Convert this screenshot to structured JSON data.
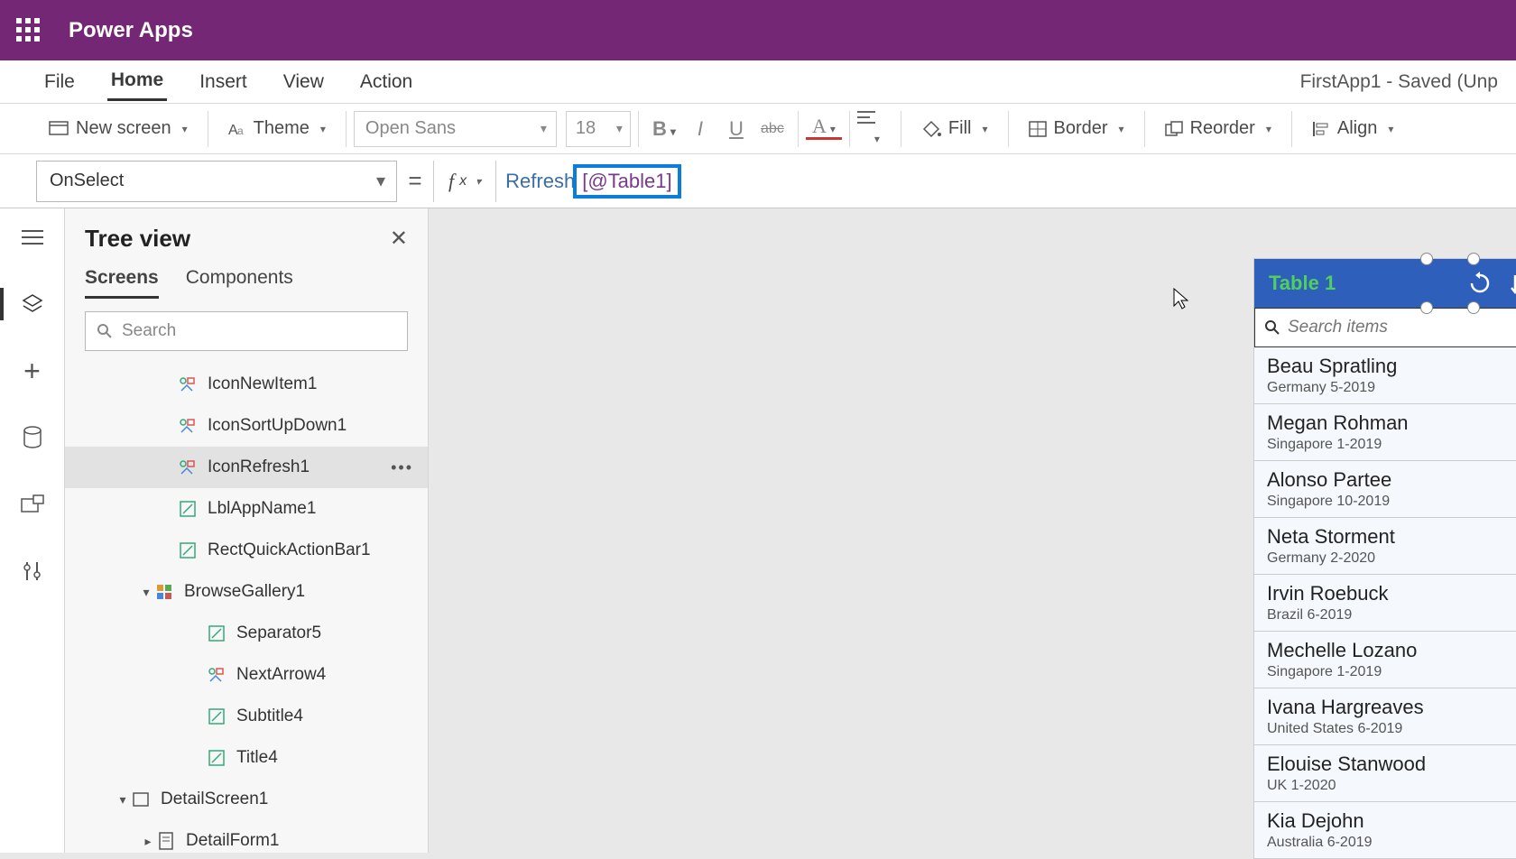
{
  "titlebar": {
    "app_name": "Power Apps"
  },
  "menubar": {
    "items": [
      "File",
      "Home",
      "Insert",
      "View",
      "Action"
    ],
    "active": "Home",
    "doc_status": "FirstApp1 - Saved (Unp"
  },
  "toolbar": {
    "new_screen": "New screen",
    "theme": "Theme",
    "font_name": "Open Sans",
    "font_size": "18",
    "fill": "Fill",
    "border": "Border",
    "reorder": "Reorder",
    "align": "Align"
  },
  "formula": {
    "property": "OnSelect",
    "fn": "Refresh",
    "arg": "[@Table1]"
  },
  "tree": {
    "title": "Tree view",
    "tabs": {
      "screens": "Screens",
      "components": "Components"
    },
    "search_placeholder": "Search",
    "items": [
      {
        "name": "IconNewItem1",
        "indent": 126,
        "icon": "group",
        "selected": false,
        "chevron": ""
      },
      {
        "name": "IconSortUpDown1",
        "indent": 126,
        "icon": "group",
        "selected": false,
        "chevron": ""
      },
      {
        "name": "IconRefresh1",
        "indent": 126,
        "icon": "group",
        "selected": true,
        "chevron": ""
      },
      {
        "name": "LblAppName1",
        "indent": 126,
        "icon": "label",
        "selected": false,
        "chevron": ""
      },
      {
        "name": "RectQuickActionBar1",
        "indent": 126,
        "icon": "label",
        "selected": false,
        "chevron": ""
      },
      {
        "name": "BrowseGallery1",
        "indent": 100,
        "icon": "gallery",
        "selected": false,
        "chevron": "▾"
      },
      {
        "name": "Separator5",
        "indent": 158,
        "icon": "label",
        "selected": false,
        "chevron": ""
      },
      {
        "name": "NextArrow4",
        "indent": 158,
        "icon": "group",
        "selected": false,
        "chevron": ""
      },
      {
        "name": "Subtitle4",
        "indent": 158,
        "icon": "label",
        "selected": false,
        "chevron": ""
      },
      {
        "name": "Title4",
        "indent": 158,
        "icon": "label",
        "selected": false,
        "chevron": ""
      },
      {
        "name": "DetailScreen1",
        "indent": 74,
        "icon": "screen",
        "selected": false,
        "chevron": "▾"
      },
      {
        "name": "DetailForm1",
        "indent": 102,
        "icon": "form",
        "selected": false,
        "chevron": "▸"
      }
    ]
  },
  "preview": {
    "header_title": "Table 1",
    "search_placeholder": "Search items",
    "records": [
      {
        "name": "Beau Spratling",
        "sub": "Germany 5-2019"
      },
      {
        "name": "Megan Rohman",
        "sub": "Singapore 1-2019"
      },
      {
        "name": "Alonso Partee",
        "sub": "Singapore 10-2019"
      },
      {
        "name": "Neta Storment",
        "sub": "Germany 2-2020"
      },
      {
        "name": "Irvin Roebuck",
        "sub": "Brazil 6-2019"
      },
      {
        "name": "Mechelle Lozano",
        "sub": "Singapore 1-2019"
      },
      {
        "name": "Ivana Hargreaves",
        "sub": "United States 6-2019"
      },
      {
        "name": "Elouise Stanwood",
        "sub": "UK 1-2020"
      },
      {
        "name": "Kia Dejohn",
        "sub": "Australia 6-2019"
      }
    ]
  }
}
